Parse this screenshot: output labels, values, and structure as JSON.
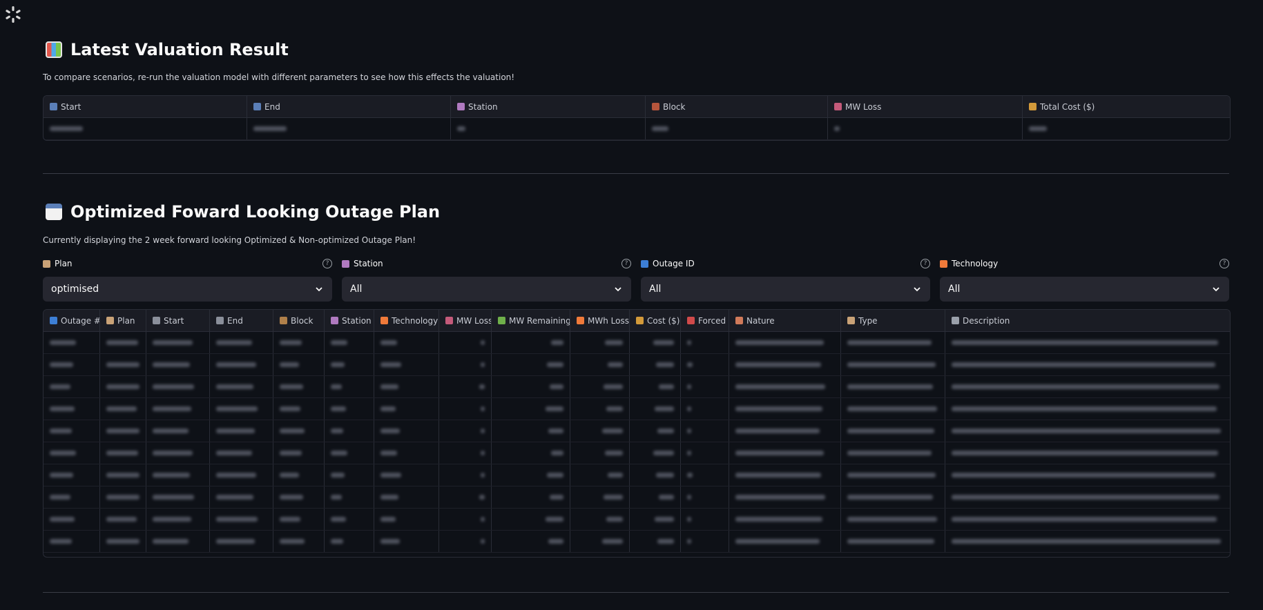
{
  "valuation": {
    "title": "Latest Valuation Result",
    "caption": "To compare scenarios, re-run the valuation model with different parameters to see how this effects the valuation!",
    "columns": [
      {
        "label": "Start",
        "icon": "calendar-icon",
        "color": "#5b7fb8"
      },
      {
        "label": "End",
        "icon": "calendar-icon",
        "color": "#5b7fb8"
      },
      {
        "label": "Station",
        "icon": "factory-icon",
        "color": "#b07ac0"
      },
      {
        "label": "Block",
        "icon": "brick-icon",
        "color": "#b5553c"
      },
      {
        "label": "MW Loss",
        "icon": "chart-down-icon",
        "color": "#c45a7a"
      },
      {
        "label": "Total Cost ($)",
        "icon": "money-bag-icon",
        "color": "#d39a3a"
      }
    ]
  },
  "outage": {
    "title": "Optimized Foward Looking Outage Plan",
    "caption": "Currently displaying the 2 week forward looking Optimized & Non-optimized Outage Plan!",
    "filters": [
      {
        "label": "Plan",
        "icon": "clipboard-icon",
        "color": "#c9a277",
        "value": "optimised"
      },
      {
        "label": "Station",
        "icon": "factory-icon",
        "color": "#b07ac0",
        "value": "All"
      },
      {
        "label": "Outage ID",
        "icon": "numbers-icon",
        "color": "#3d7fd6",
        "value": "All"
      },
      {
        "label": "Technology",
        "icon": "lightning-icon",
        "color": "#f07a3a",
        "value": "All"
      }
    ],
    "columns": [
      {
        "label": "Outage #",
        "icon": "numbers-icon",
        "color": "#3d7fd6"
      },
      {
        "label": "Plan",
        "icon": "clipboard-icon",
        "color": "#c9a277"
      },
      {
        "label": "Start",
        "icon": "clock-icon",
        "color": "#8a8f9a"
      },
      {
        "label": "End",
        "icon": "clock-icon",
        "color": "#8a8f9a"
      },
      {
        "label": "Block",
        "icon": "box-icon",
        "color": "#b0804a"
      },
      {
        "label": "Station",
        "icon": "factory-icon",
        "color": "#b07ac0"
      },
      {
        "label": "Technology",
        "icon": "lightning-icon",
        "color": "#f07a3a"
      },
      {
        "label": "MW Loss",
        "icon": "chart-down-icon",
        "color": "#c45a7a"
      },
      {
        "label": "MW Remaining",
        "icon": "battery-icon",
        "color": "#6fb04a"
      },
      {
        "label": "MWh Loss",
        "icon": "lightning-icon",
        "color": "#f07a3a"
      },
      {
        "label": "Cost ($)",
        "icon": "money-bag-icon",
        "color": "#d39a3a"
      },
      {
        "label": "Forced",
        "icon": "construction-icon",
        "color": "#d04a4a"
      },
      {
        "label": "Nature",
        "icon": "document-icon",
        "color": "#d07a5a"
      },
      {
        "label": "Type",
        "icon": "clipboard-icon",
        "color": "#c9a277"
      },
      {
        "label": "Description",
        "icon": "speech-icon",
        "color": "#9aa0aa"
      }
    ]
  }
}
